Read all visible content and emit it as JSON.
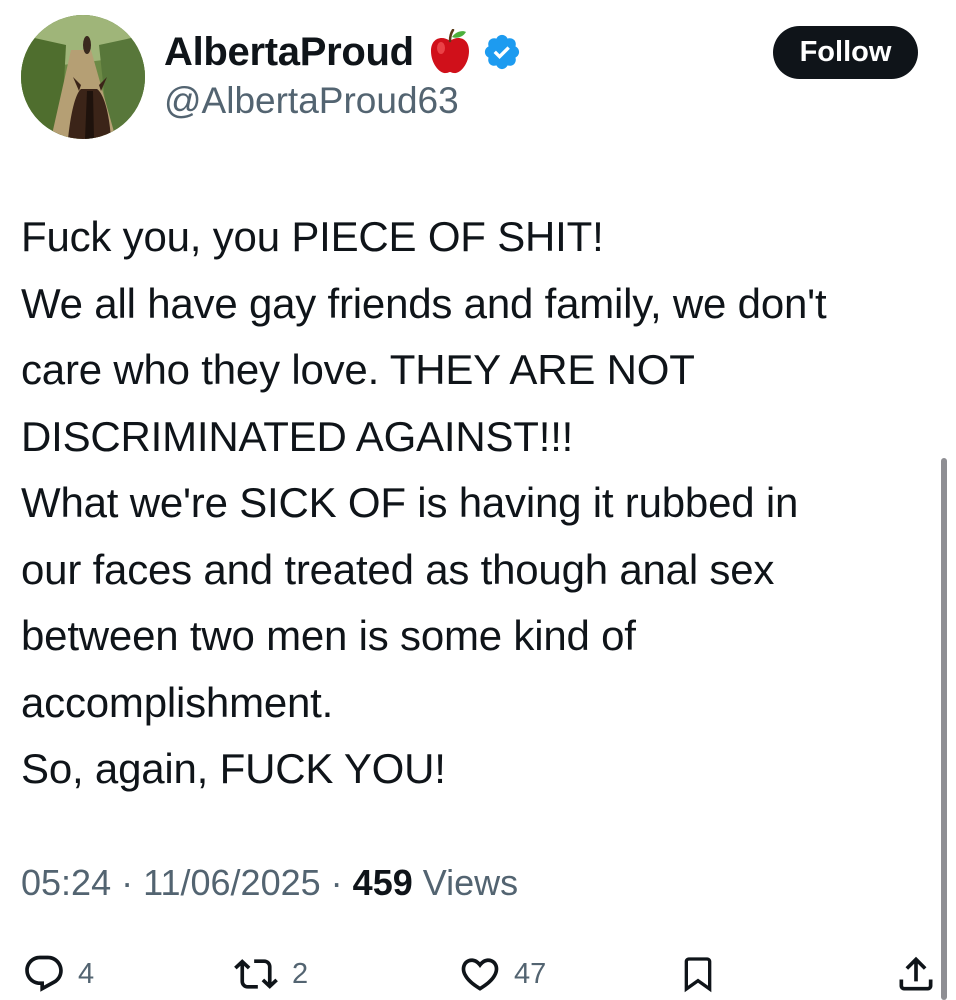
{
  "author": {
    "display_name": "AlbertaProud",
    "name_emoji": "apple-icon",
    "verified_badge": "verified-badge-icon",
    "handle": "@AlbertaProud63",
    "avatar": "avatar-horse-trail-photo"
  },
  "follow_button": {
    "label": "Follow"
  },
  "tweet": {
    "lines": [
      "Fuck you, you PIECE OF SHIT!",
      "We all have gay friends and family, we don't",
      "care who they love. THEY ARE NOT",
      "DISCRIMINATED AGAINST!!!",
      "What we're SICK OF is having it rubbed in",
      "our faces and treated as though anal sex",
      "between two men is some kind of",
      "accomplishment.",
      "So, again, FUCK YOU!"
    ]
  },
  "meta": {
    "time": "05:24",
    "separator": "·",
    "date": "11/06/2025",
    "views_count": "459",
    "views_label": "Views"
  },
  "actions": {
    "reply": {
      "icon": "reply-icon",
      "count": "4"
    },
    "retweet": {
      "icon": "retweet-icon",
      "count": "2"
    },
    "like": {
      "icon": "heart-icon",
      "count": "47"
    },
    "bookmark": {
      "icon": "bookmark-icon"
    },
    "share": {
      "icon": "share-icon"
    }
  },
  "colors": {
    "text_primary": "#0f1419",
    "text_secondary": "#536471",
    "verified_blue": "#1d9bf0",
    "apple_red": "#d0101a",
    "follow_bg": "#0f1419",
    "scrollbar": "#8e8e93"
  }
}
